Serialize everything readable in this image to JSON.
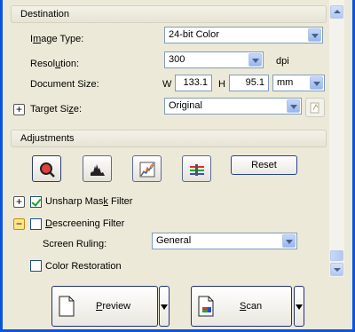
{
  "destination": {
    "header": "Destination",
    "image_type": {
      "pre": "I",
      "ul": "m",
      "post": "age Type:",
      "value": "24-bit Color"
    },
    "resolution": {
      "pre": "Resol",
      "ul": "u",
      "post": "tion:",
      "value": "300",
      "unit": "dpi"
    },
    "document_size": {
      "label": "Document Size:",
      "w_label": "W",
      "w_value": "133.1",
      "h_label": "H",
      "h_value": "95.1",
      "unit": "mm"
    },
    "target_size": {
      "pre": "Target Si",
      "ul": "z",
      "post": "e:",
      "value": "Original"
    }
  },
  "adjustments": {
    "header": "Adjustments",
    "tools": [
      "auto-exposure-icon",
      "histogram-icon",
      "tone-correction-icon",
      "image-adjustment-icon"
    ],
    "reset_label": "Reset",
    "unsharp_mask": {
      "pre": "Unsharp Mas",
      "ul": "k",
      "post": " Filter",
      "checked": true
    },
    "descreening": {
      "pre": "",
      "ul": "D",
      "post": "escreening Filter",
      "checked": false
    },
    "screen_ruling": {
      "label": "Screen Ruling:",
      "value": "General"
    },
    "color_restoration": {
      "label": "Color Restoration",
      "checked": false
    }
  },
  "actions": {
    "preview": {
      "pre": "",
      "ul": "P",
      "post": "review"
    },
    "scan": {
      "pre": "",
      "ul": "S",
      "post": "can"
    }
  }
}
